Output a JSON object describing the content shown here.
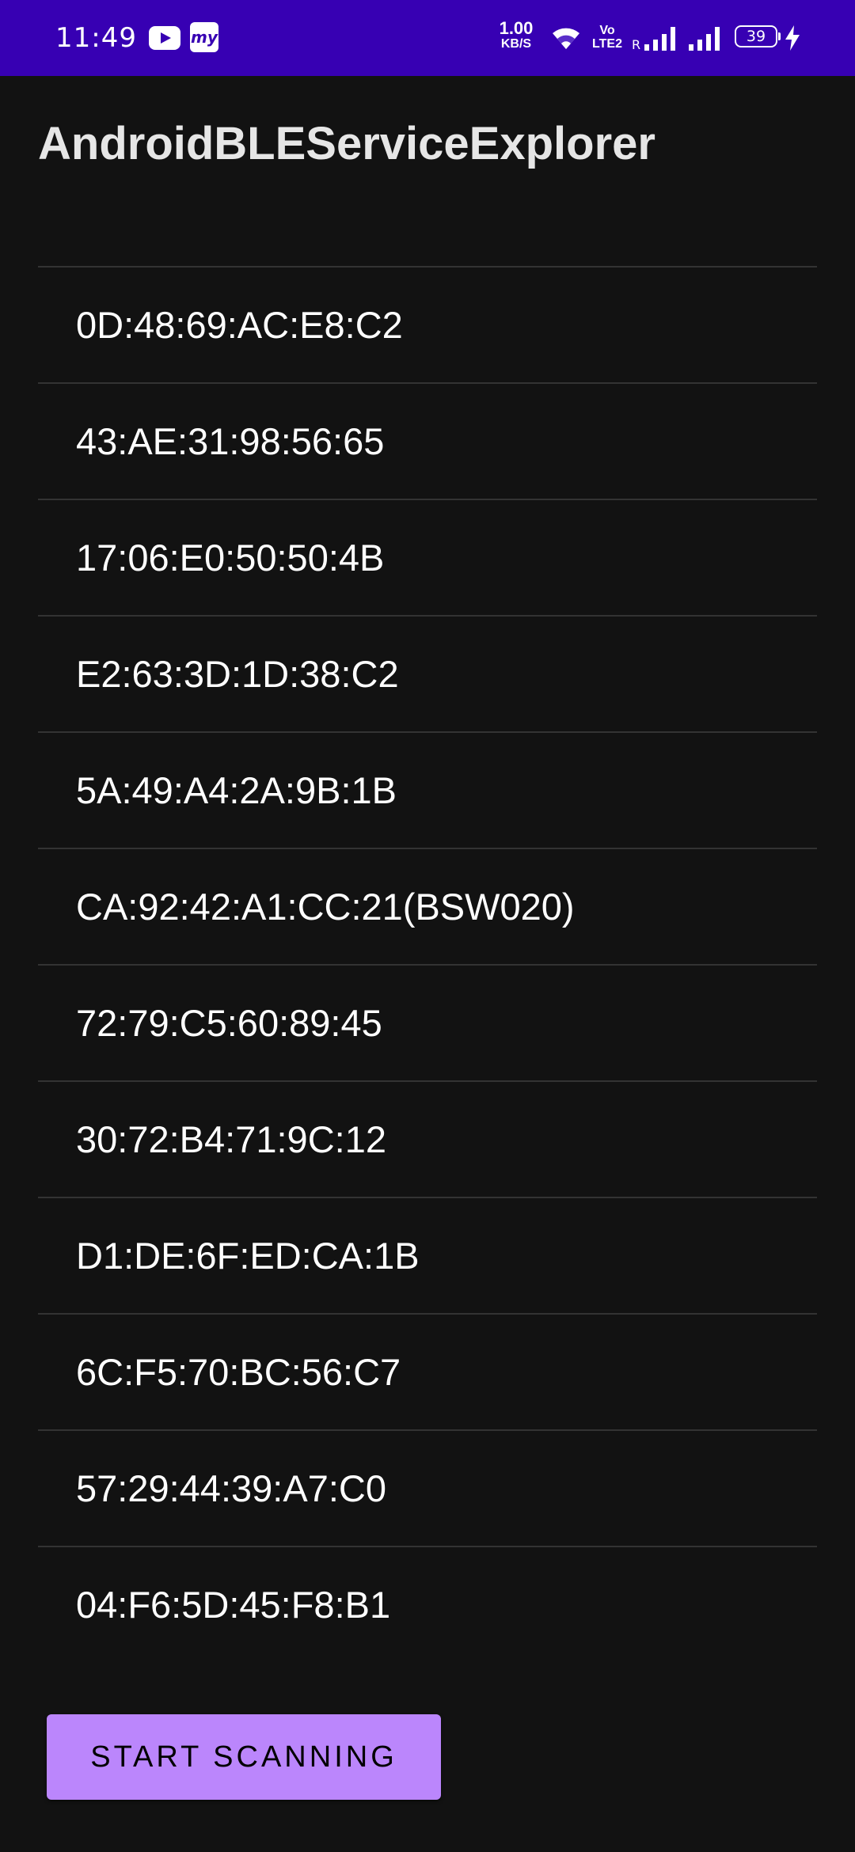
{
  "status_bar": {
    "time": "11:49",
    "app_icons": [
      "youtube-icon",
      "mytelco-app-icon"
    ],
    "my_app_label": "my",
    "net_speed_value": "1.00",
    "net_speed_unit": "KB/S",
    "wifi_icon": "wifi-icon",
    "volte_label": "Vo LTE2",
    "roaming_label": "R",
    "battery_level": "39",
    "background_color": "#3700b3"
  },
  "app_bar": {
    "title": "AndroidBLEServiceExplorer"
  },
  "devices": [
    {
      "label": "0D:48:69:AC:E8:C2"
    },
    {
      "label": "43:AE:31:98:56:65"
    },
    {
      "label": "17:06:E0:50:50:4B"
    },
    {
      "label": "E2:63:3D:1D:38:C2"
    },
    {
      "label": "5A:49:A4:2A:9B:1B"
    },
    {
      "label": "CA:92:42:A1:CC:21(BSW020)"
    },
    {
      "label": "72:79:C5:60:89:45"
    },
    {
      "label": "30:72:B4:71:9C:12"
    },
    {
      "label": "D1:DE:6F:ED:CA:1B"
    },
    {
      "label": "6C:F5:70:BC:56:C7"
    },
    {
      "label": "57:29:44:39:A7:C0"
    },
    {
      "label": "04:F6:5D:45:F8:B1"
    }
  ],
  "scan_button": {
    "label": "START SCANNING",
    "color": "#bb86fc"
  },
  "theme": {
    "background": "#121212",
    "divider": "#333333",
    "text": "#ffffff"
  }
}
